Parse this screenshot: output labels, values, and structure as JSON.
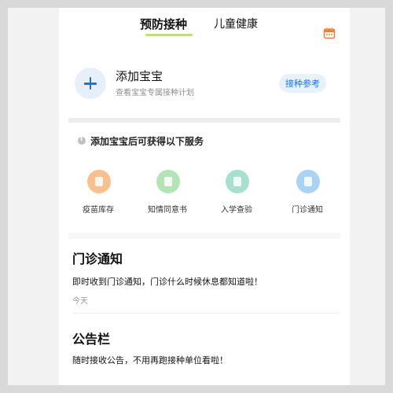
{
  "header": {
    "tab_active": "预防接种",
    "tab_inactive": "儿童健康",
    "calendar_icon": "calendar-icon",
    "accent_color": "#b9ec3a"
  },
  "add_baby": {
    "title": "添加宝宝",
    "subtitle": "查看宝宝专属接种计划",
    "reference_button": "接种参考",
    "icon": "plus-icon",
    "brand_color": "#1f73d8"
  },
  "services": {
    "header": "添加宝宝后可获得以下服务",
    "items": [
      {
        "label": "疫苗库存",
        "icon": "vaccine-stock-icon",
        "color": "#f8c08f"
      },
      {
        "label": "知情同意书",
        "icon": "consent-form-icon",
        "color": "#b5e3b8"
      },
      {
        "label": "入学查验",
        "icon": "school-check-icon",
        "color": "#a8dfcf"
      },
      {
        "label": "门诊通知",
        "icon": "clinic-notice-icon",
        "color": "#a9d2f5"
      }
    ]
  },
  "clinic_notice": {
    "title": "门诊通知",
    "desc": "即时收到门诊通知，门诊什么时候休息都知道啦！",
    "time": "今天"
  },
  "bulletin": {
    "title": "公告栏",
    "desc": "随时接收公告，不用再跑接种单位看啦！"
  }
}
